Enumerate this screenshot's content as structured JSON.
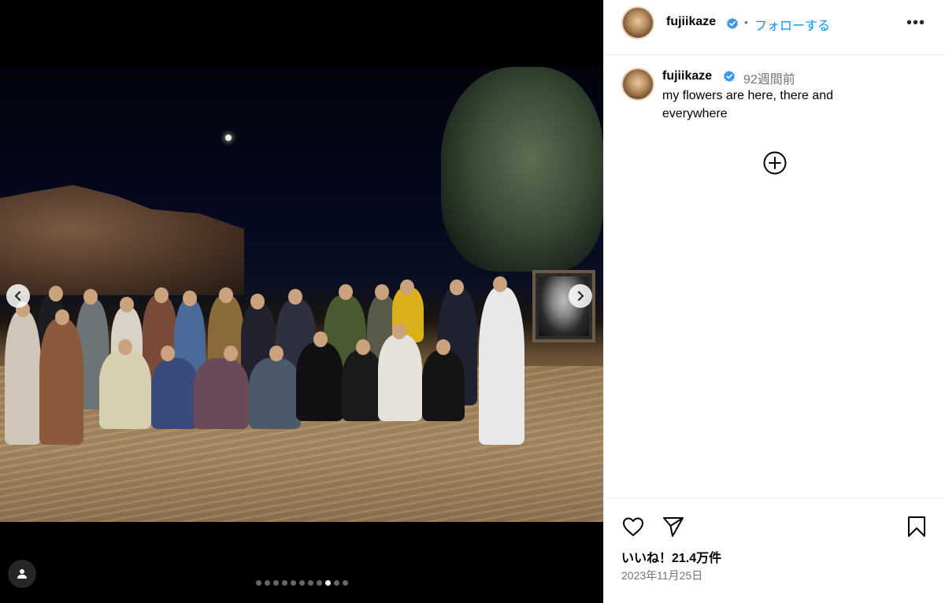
{
  "post": {
    "media": {
      "slide_count": 11,
      "active_slide": 9,
      "tag_icon": "user-icon",
      "prev_icon": "chevron-left-icon",
      "next_icon": "chevron-right-icon"
    },
    "header": {
      "username": "fujiikaze",
      "verified_icon": "verified-badge-icon",
      "separator": "•",
      "follow_label": "フォローする",
      "more_label": "•••"
    },
    "caption": {
      "username": "fujiikaze",
      "time_ago": "92週間前",
      "text": "my flowers are here, there and everywhere",
      "more_comments_icon": "plus-circle-icon"
    },
    "actions": {
      "like_icon": "heart-icon",
      "share_icon": "send-icon",
      "save_icon": "bookmark-icon",
      "likes_text": "いいね！21.4万件",
      "date_text": "2023年11月25日"
    },
    "colors": {
      "link": "#0095f6",
      "verified": "#3897f0",
      "secondary_text": "#737373"
    }
  }
}
